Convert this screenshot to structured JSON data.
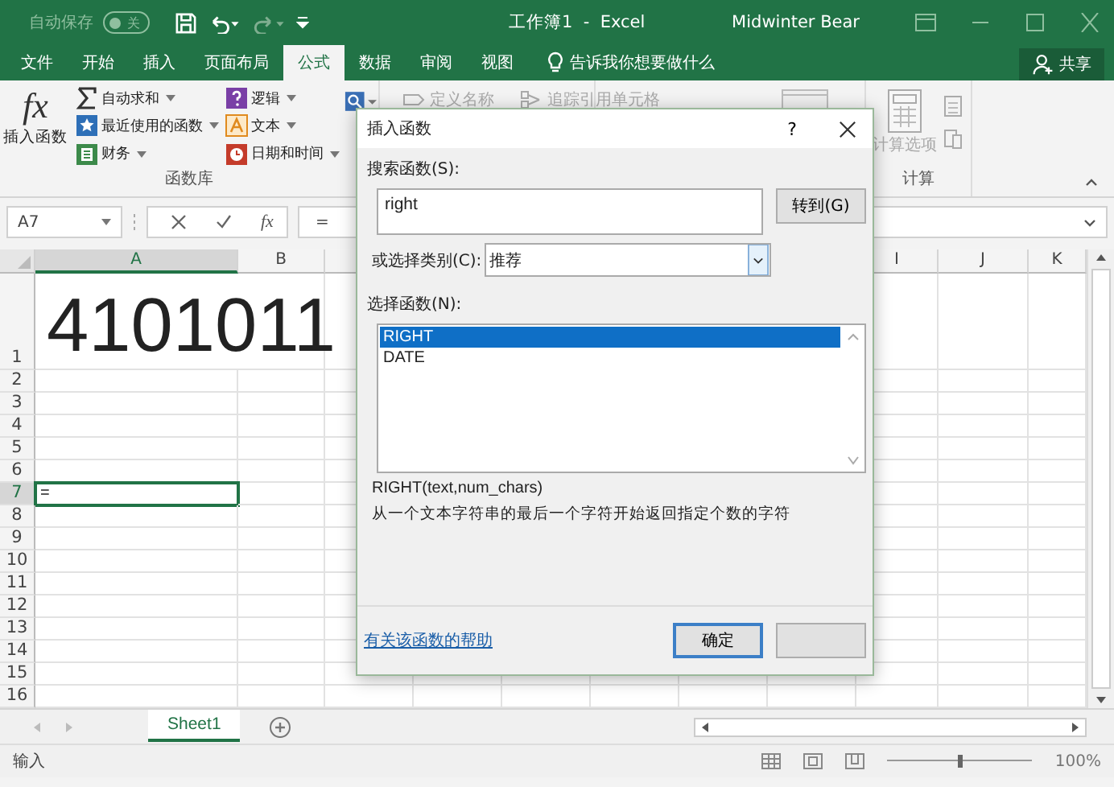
{
  "title_bar": {
    "autosave_label": "自动保存",
    "autosave_toggle": {
      "label": "关",
      "on": false
    },
    "title": "工作簿1  -  Excel",
    "user": "Midwinter Bear"
  },
  "ribbon_tabs": [
    {
      "label": "文件",
      "selected": false
    },
    {
      "label": "开始",
      "selected": false
    },
    {
      "label": "插入",
      "selected": false
    },
    {
      "label": "页面布局",
      "selected": false
    },
    {
      "label": "公式",
      "selected": true
    },
    {
      "label": "数据",
      "selected": false
    },
    {
      "label": "审阅",
      "selected": false
    },
    {
      "label": "视图",
      "selected": false
    }
  ],
  "tell_me": "告诉我你想要做什么",
  "share_button": "共享",
  "ribbon": {
    "insert_function": {
      "symbol": "fx",
      "label": "插入函数"
    },
    "library_columns": [
      [
        {
          "label": "自动求和",
          "kind": "sum"
        },
        {
          "label": "最近使用的函数",
          "kind": "star"
        },
        {
          "label": "财务",
          "kind": "book"
        }
      ],
      [
        {
          "label": "逻辑",
          "kind": "logic"
        },
        {
          "label": "文本",
          "kind": "text"
        },
        {
          "label": "日期和时间",
          "kind": "clock"
        }
      ]
    ],
    "library_label": "函数库",
    "disabled_items": [
      {
        "label": "定义名称",
        "kind": "tag"
      },
      {
        "label": "追踪引用单元格",
        "kind": "trace"
      }
    ],
    "calc_options": "计算选项",
    "calc_label": "计算"
  },
  "formula_bar": {
    "name_box": "A7",
    "function_symbol": "fx",
    "formula": "="
  },
  "sheet": {
    "columns": [
      {
        "label": "A",
        "selected": true
      },
      {
        "label": "B",
        "selected": false
      },
      {
        "label": "I",
        "selected": false
      },
      {
        "label": "J",
        "selected": false
      },
      {
        "label": "K",
        "selected": false
      }
    ],
    "rows": [
      {
        "label": "1",
        "selected": false,
        "cells": {
          "A": {
            "text": "4101011",
            "active": false
          }
        }
      },
      {
        "label": "2",
        "selected": false
      },
      {
        "label": "3",
        "selected": false
      },
      {
        "label": "4",
        "selected": false
      },
      {
        "label": "5",
        "selected": false
      },
      {
        "label": "6",
        "selected": false
      },
      {
        "label": "7",
        "selected": true,
        "cells": {
          "A": {
            "text": "=",
            "active": true
          }
        }
      },
      {
        "label": "8",
        "selected": false
      },
      {
        "label": "9",
        "selected": false
      },
      {
        "label": "10",
        "selected": false
      },
      {
        "label": "11",
        "selected": false
      },
      {
        "label": "12",
        "selected": false
      },
      {
        "label": "13",
        "selected": false
      },
      {
        "label": "14",
        "selected": false
      },
      {
        "label": "15",
        "selected": false
      },
      {
        "label": "16",
        "selected": false
      }
    ]
  },
  "sheet_tabs": [
    {
      "label": "Sheet1",
      "selected": true
    }
  ],
  "status_bar": {
    "mode": "输入",
    "zoom": "100%",
    "zoom_slider": {
      "level": 0.5
    }
  },
  "dialog": {
    "title": "插入函数",
    "help": "?",
    "search_label": "搜索函数(S):",
    "search_value": "right",
    "go_button": "转到(G)",
    "category_label": "或选择类别(C):",
    "category_value": "推荐",
    "list_label": "选择函数(N):",
    "functions": [
      {
        "name": "RIGHT",
        "selected": true
      },
      {
        "name": "DATE",
        "selected": false
      }
    ],
    "signature": "RIGHT(text,num_chars)",
    "description": "从一个文本字符串的最后一个字符开始返回指定个数的字符",
    "help_link": "有关该函数的帮助",
    "ok_button": "确定"
  }
}
